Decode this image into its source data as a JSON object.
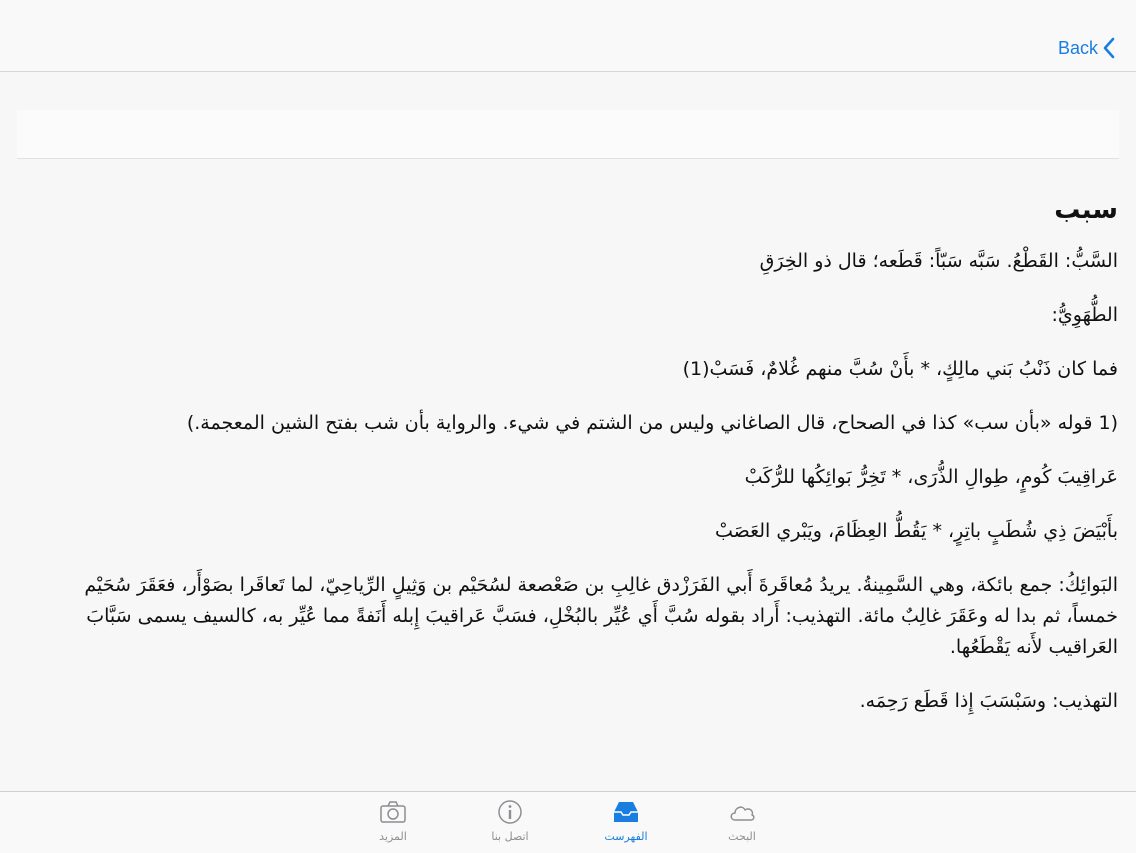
{
  "navbar": {
    "back_label": "Back"
  },
  "article": {
    "headword": "سبب",
    "paragraphs": [
      "السَّبُّ: القَطْعُ. سَبَّه سَبّاً: قَطَعه؛ قال ذو الخِرَقِ",
      "الطُّهَوِيُّ:",
      "فما كان ذَنْبُ بَني مالِكٍ، * بأَنْ سُبَّ منهم غُلامٌ، فَسَبْ(1)",
      "(1 قوله «بأن سب» كذا في الصحاح، قال الصاغاني وليس من الشتم في شيء. والرواية بأن شب بفتح الشين المعجمة.)",
      "عَراقِيبَ كُومٍ، طِوالِ الذُّرَى، * تَخِرُّ بَوائِكُها للرُّكَبْ",
      "بأَبْيَضَ ذِي شُطَبٍ باتِرٍ، * يَقُطُّ العِظَامَ، ويَبْري العَصَبْ",
      "البَوائِكُ: جمع بائكة، وهي السَّمِينةُ. يريدُ مُعاقَرةَ أَبي الفَرَزْدق غالِبِ بن صَعْصعة لسُحَيْم بن وَثِيلٍ الرِّياحِيّ، لما تَعاقَرا بصَوْأَر، فعَقَرَ سُحَيْم خمساً، ثم بدا له وعَقَرَ غالِبٌ مائة. التهذيب: أَراد بقوله سُبَّ أَي عُيِّر بالبُخْلِ، فسَبَّ عَراقيبَ إِبله أَنَفةً مما عُيِّر به، كالسيف يسمى سَبَّابَ العَراقيب لأَنه يَقْطَعُها.",
      "التهذيب: وسَبْسَبَ إِذا قَطَع رَحِمَه."
    ]
  },
  "tabbar": {
    "tabs": [
      {
        "label": "المزيد",
        "icon": "camera-icon",
        "active": false
      },
      {
        "label": "اتصل بنا",
        "icon": "info-icon",
        "active": false
      },
      {
        "label": "الفهرست",
        "icon": "tray-icon",
        "active": true
      },
      {
        "label": "البحث",
        "icon": "cloud-icon",
        "active": false
      }
    ]
  },
  "colors": {
    "accent": "#1a7ee0",
    "inactive": "#8e8e93"
  }
}
